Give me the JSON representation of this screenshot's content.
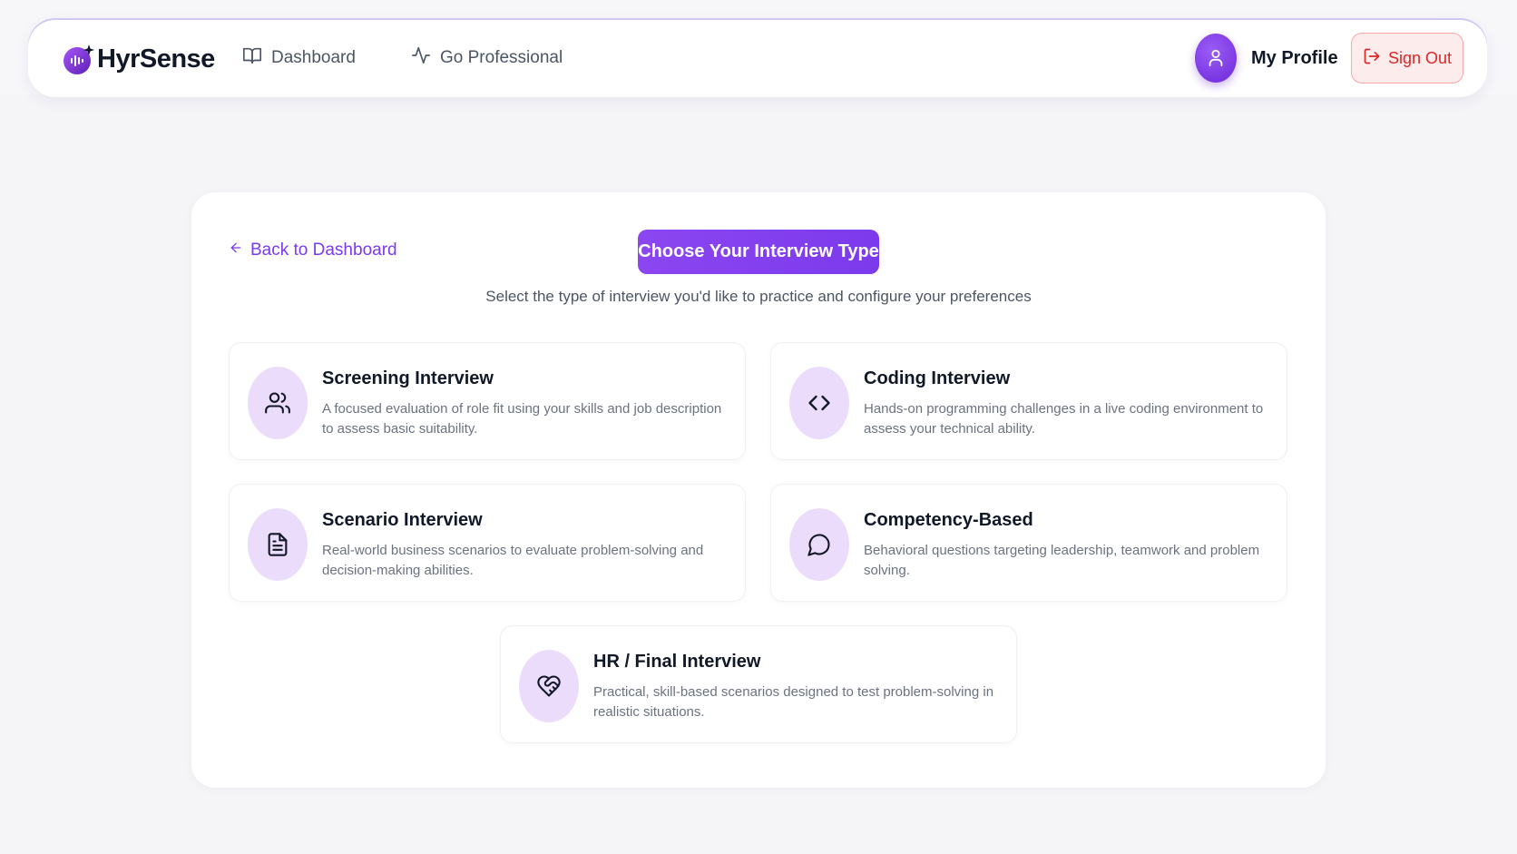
{
  "header": {
    "logo_text": "HyrSense",
    "nav": [
      {
        "label": "Dashboard",
        "icon": "book-open-icon"
      },
      {
        "label": "Go Professional",
        "icon": "activity-icon"
      }
    ],
    "profile_label": "My Profile",
    "signout_label": "Sign Out"
  },
  "main": {
    "back_label": "Back to Dashboard",
    "title": "Choose Your Interview Type",
    "subtitle": "Select the type of interview you'd like to practice and configure your preferences",
    "types": [
      {
        "title": "Screening Interview",
        "desc": "A focused evaluation of role fit using your skills and job description to assess basic suitability.",
        "icon": "users-icon"
      },
      {
        "title": "Coding Interview",
        "desc": "Hands-on programming challenges in a live coding environment to assess your technical ability.",
        "icon": "code-icon"
      },
      {
        "title": "Scenario Interview",
        "desc": "Real-world business scenarios to evaluate problem-solving and decision-making abilities.",
        "icon": "document-icon"
      },
      {
        "title": "Competency-Based",
        "desc": "Behavioral questions targeting leadership, teamwork and problem solving.",
        "icon": "chat-bubble-icon"
      },
      {
        "title": "HR / Final Interview",
        "desc": "Practical, skill-based scenarios designed to test problem-solving in realistic situations.",
        "icon": "heart-handshake-icon"
      }
    ]
  },
  "colors": {
    "accent": "#7c3aed",
    "icon_bg": "#ecdcfb",
    "danger": "#dc2626",
    "danger_bg": "#fdecec"
  }
}
